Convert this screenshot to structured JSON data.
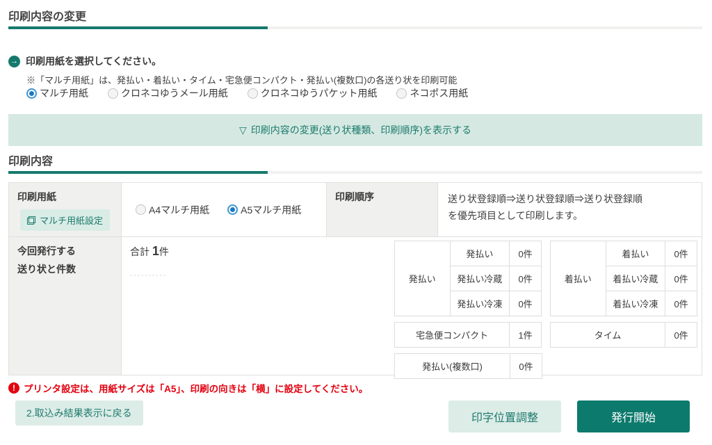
{
  "sections": {
    "change_title": "印刷内容の変更",
    "content_title": "印刷内容"
  },
  "paper_select": {
    "prompt_icon": "→",
    "prompt": "印刷用紙を選択してください。",
    "note": "※「マルチ用紙」は、発払い・着払い・タイム・宅急便コンパクト・発払い(複数口)の各送り状を印刷可能",
    "options": [
      {
        "label": "マルチ用紙",
        "selected": true
      },
      {
        "label": "クロネコゆうメール用紙",
        "selected": false
      },
      {
        "label": "クロネコゆうパケット用紙",
        "selected": false
      },
      {
        "label": "ネコポス用紙",
        "selected": false
      }
    ]
  },
  "toggle_banner": {
    "icon": "▽",
    "label": "印刷内容の変更(送り状種類、印刷順序)を表示する"
  },
  "print_settings": {
    "paper_header": "印刷用紙",
    "paper_settings_button": "マルチ用紙設定",
    "paper_options": [
      {
        "label": "A4マルチ用紙",
        "selected": false
      },
      {
        "label": "A5マルチ用紙",
        "selected": true
      }
    ],
    "order_header": "印刷順序",
    "order_line1": "送り状登録順⇒送り状登録順⇒送り状登録順",
    "order_line2": "を優先項目として印刷します。",
    "issue_header_line1": "今回発行する",
    "issue_header_line2": "送り状と件数"
  },
  "shipment_counts": {
    "total_label": "合計",
    "total_value": "1",
    "total_unit": "件",
    "placeholder": "----------",
    "groups": [
      {
        "group": "発払い",
        "rows": [
          {
            "label": "発払い",
            "count": "0件"
          },
          {
            "label": "発払い冷蔵",
            "count": "0件"
          },
          {
            "label": "発払い冷凍",
            "count": "0件"
          }
        ]
      },
      {
        "group": "着払い",
        "rows": [
          {
            "label": "着払い",
            "count": "0件"
          },
          {
            "label": "着払い冷蔵",
            "count": "0件"
          },
          {
            "label": "着払い冷凍",
            "count": "0件"
          }
        ]
      }
    ],
    "singles": [
      {
        "label": "宅急便コンパクト",
        "count": "1件"
      },
      {
        "label": "タイム",
        "count": "0件"
      },
      {
        "label": "発払い(複数口)",
        "count": "0件"
      }
    ]
  },
  "warning": {
    "icon": "!",
    "text": "プリンタ設定は、用紙サイズは「A5」、印刷の向きは「横」に設定してください。"
  },
  "footer": {
    "back_button": "2.取込み結果表示に戻る",
    "adjust_button": "印字位置調整",
    "issue_button": "発行開始"
  },
  "colors": {
    "accent_teal": "#0c7a6c",
    "light_teal_bg": "#dcece7",
    "banner_bg": "#d5e9e2",
    "header_cell_bg": "#f0f0ee",
    "warning_red": "#e3000f",
    "radio_selected_blue": "#1b79c4"
  }
}
